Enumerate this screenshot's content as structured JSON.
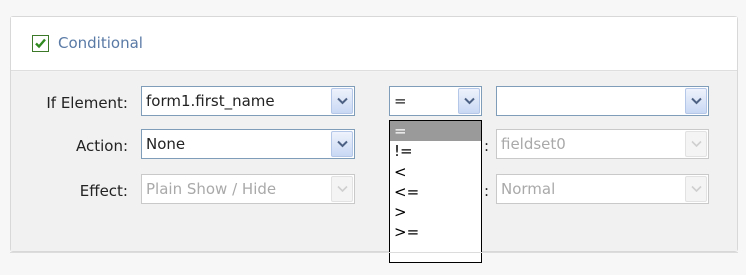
{
  "conditional": {
    "enabled": true,
    "label": "Conditional"
  },
  "if_element": {
    "label": "If Element:",
    "value": "form1.first_name"
  },
  "operator": {
    "value": "=",
    "options": [
      "=",
      "!=",
      "<",
      "<=",
      ">",
      ">="
    ],
    "selected_index": 0
  },
  "compare_value": {
    "value": ""
  },
  "action": {
    "label": "Action:",
    "value": "None"
  },
  "target": {
    "value": "fieldset0",
    "disabled": true
  },
  "effect": {
    "label": "Effect:",
    "value": "Plain Show / Hide",
    "disabled": true
  },
  "speed": {
    "value": "Normal",
    "disabled": true
  },
  "colors": {
    "check": "#2f8a1f",
    "header_text": "#5a7aa6",
    "select_border": "#7f9db9",
    "disabled_text": "#a9a9a9"
  }
}
